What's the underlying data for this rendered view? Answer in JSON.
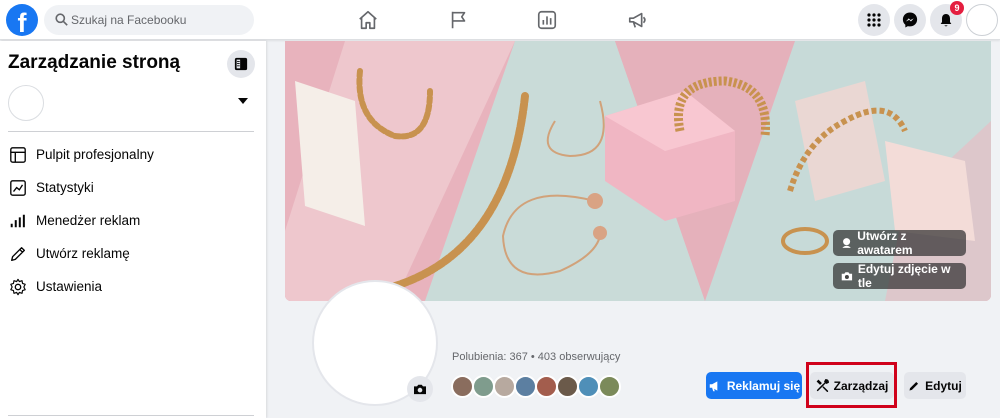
{
  "topbar": {
    "logo": "f",
    "search_placeholder": "Szukaj na Facebooku",
    "nav_icons": [
      "home-icon",
      "flag-icon",
      "chart-icon",
      "megaphone-icon"
    ],
    "notifications_count": "9"
  },
  "sidebar": {
    "title": "Zarządzanie stroną",
    "items": [
      {
        "label": "Pulpit profesjonalny",
        "icon": "dashboard-icon"
      },
      {
        "label": "Statystyki",
        "icon": "statistics-icon"
      },
      {
        "label": "Menedżer reklam",
        "icon": "bars-icon"
      },
      {
        "label": "Utwórz reklamę",
        "icon": "pencil-icon"
      },
      {
        "label": "Ustawienia",
        "icon": "gear-icon"
      }
    ]
  },
  "cover": {
    "avatar_button": "Utwórz z awatarem",
    "edit_photo_button": "Edytuj zdjęcie w tle"
  },
  "profile": {
    "stats": "Polubienia: 367 • 403 obserwujący",
    "friend_count": 8
  },
  "actions": {
    "advertise": "Reklamuj się",
    "manage": "Zarządzaj",
    "edit": "Edytuj"
  },
  "colors": {
    "brand": "#1877f2",
    "highlight": "#d0021b",
    "badge": "#e41e3f"
  }
}
